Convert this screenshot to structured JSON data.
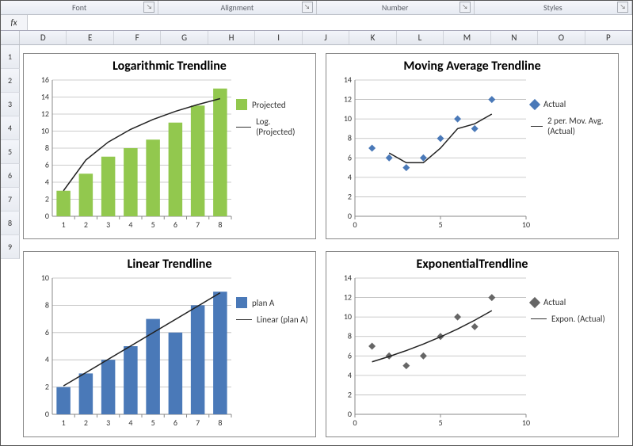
{
  "ribbon": {
    "groups": [
      "Font",
      "Alignment",
      "Number",
      "Styles"
    ]
  },
  "formula_bar": {
    "fx": "fx"
  },
  "columns": [
    "D",
    "E",
    "F",
    "G",
    "H",
    "I",
    "J",
    "K",
    "L",
    "M",
    "N",
    "O",
    "P"
  ],
  "rows": [
    "1",
    "2",
    "3",
    "4",
    "5",
    "6",
    "7",
    "8",
    "9"
  ],
  "charts": {
    "log": {
      "title": "Logarithmic Trendline",
      "legend": {
        "series": "Projected",
        "trend": "Log. (Projected)"
      }
    },
    "mavg": {
      "title": "Moving Average Trendline",
      "legend": {
        "series": "Actual",
        "trend": "2 per. Mov. Avg. (Actual)"
      }
    },
    "linear": {
      "title": "Linear Trendline",
      "legend": {
        "series": "plan A",
        "trend": "Linear (plan A)"
      }
    },
    "expo": {
      "title": "ExponentialTrendline",
      "legend": {
        "series": "Actual",
        "trend": "Expon. (Actual)"
      }
    }
  },
  "chart_data": [
    {
      "id": "log",
      "type": "bar",
      "title": "Logarithmic Trendline",
      "categories": [
        1,
        2,
        3,
        4,
        5,
        6,
        7,
        8
      ],
      "series": [
        {
          "name": "Projected",
          "values": [
            3,
            5,
            7,
            8,
            9,
            11,
            13,
            15
          ]
        }
      ],
      "trendline": {
        "type": "logarithmic",
        "name": "Log. (Projected)"
      },
      "ylim": [
        0,
        16
      ],
      "yticks": [
        0,
        2,
        4,
        6,
        8,
        10,
        12,
        14,
        16
      ],
      "xlabel": "",
      "ylabel": ""
    },
    {
      "id": "mavg",
      "type": "scatter",
      "title": "Moving Average Trendline",
      "x": [
        1,
        2,
        3,
        4,
        5,
        6,
        7,
        8
      ],
      "series": [
        {
          "name": "Actual",
          "y": [
            7,
            6,
            5,
            6,
            8,
            10,
            9,
            12
          ]
        }
      ],
      "trendline": {
        "type": "moving_average",
        "period": 2,
        "name": "2 per. Mov. Avg. (Actual)",
        "y": [
          null,
          6.5,
          5.5,
          5.5,
          7,
          9,
          9.5,
          10.5
        ]
      },
      "xlim": [
        0,
        10
      ],
      "ylim": [
        0,
        14
      ],
      "xticks": [
        0,
        5,
        10
      ],
      "yticks": [
        0,
        2,
        4,
        6,
        8,
        10,
        12,
        14
      ],
      "xlabel": "",
      "ylabel": ""
    },
    {
      "id": "linear",
      "type": "bar",
      "title": "Linear Trendline",
      "categories": [
        1,
        2,
        3,
        4,
        5,
        6,
        7,
        8
      ],
      "series": [
        {
          "name": "plan A",
          "values": [
            2,
            3,
            4,
            5,
            7,
            6,
            8,
            9
          ]
        }
      ],
      "trendline": {
        "type": "linear",
        "name": "Linear (plan A)"
      },
      "ylim": [
        0,
        10
      ],
      "yticks": [
        0,
        2,
        4,
        6,
        8,
        10
      ],
      "xlabel": "",
      "ylabel": ""
    },
    {
      "id": "expo",
      "type": "scatter",
      "title": "ExponentialTrendline",
      "x": [
        1,
        2,
        3,
        4,
        5,
        6,
        7,
        8
      ],
      "series": [
        {
          "name": "Actual",
          "y": [
            7,
            6,
            5,
            6,
            8,
            10,
            9,
            12
          ]
        }
      ],
      "trendline": {
        "type": "exponential",
        "name": "Expon. (Actual)"
      },
      "xlim": [
        0,
        10
      ],
      "ylim": [
        0,
        14
      ],
      "xticks": [
        0,
        5,
        10
      ],
      "yticks": [
        0,
        2,
        4,
        6,
        8,
        10,
        12,
        14
      ],
      "xlabel": "",
      "ylabel": ""
    }
  ]
}
